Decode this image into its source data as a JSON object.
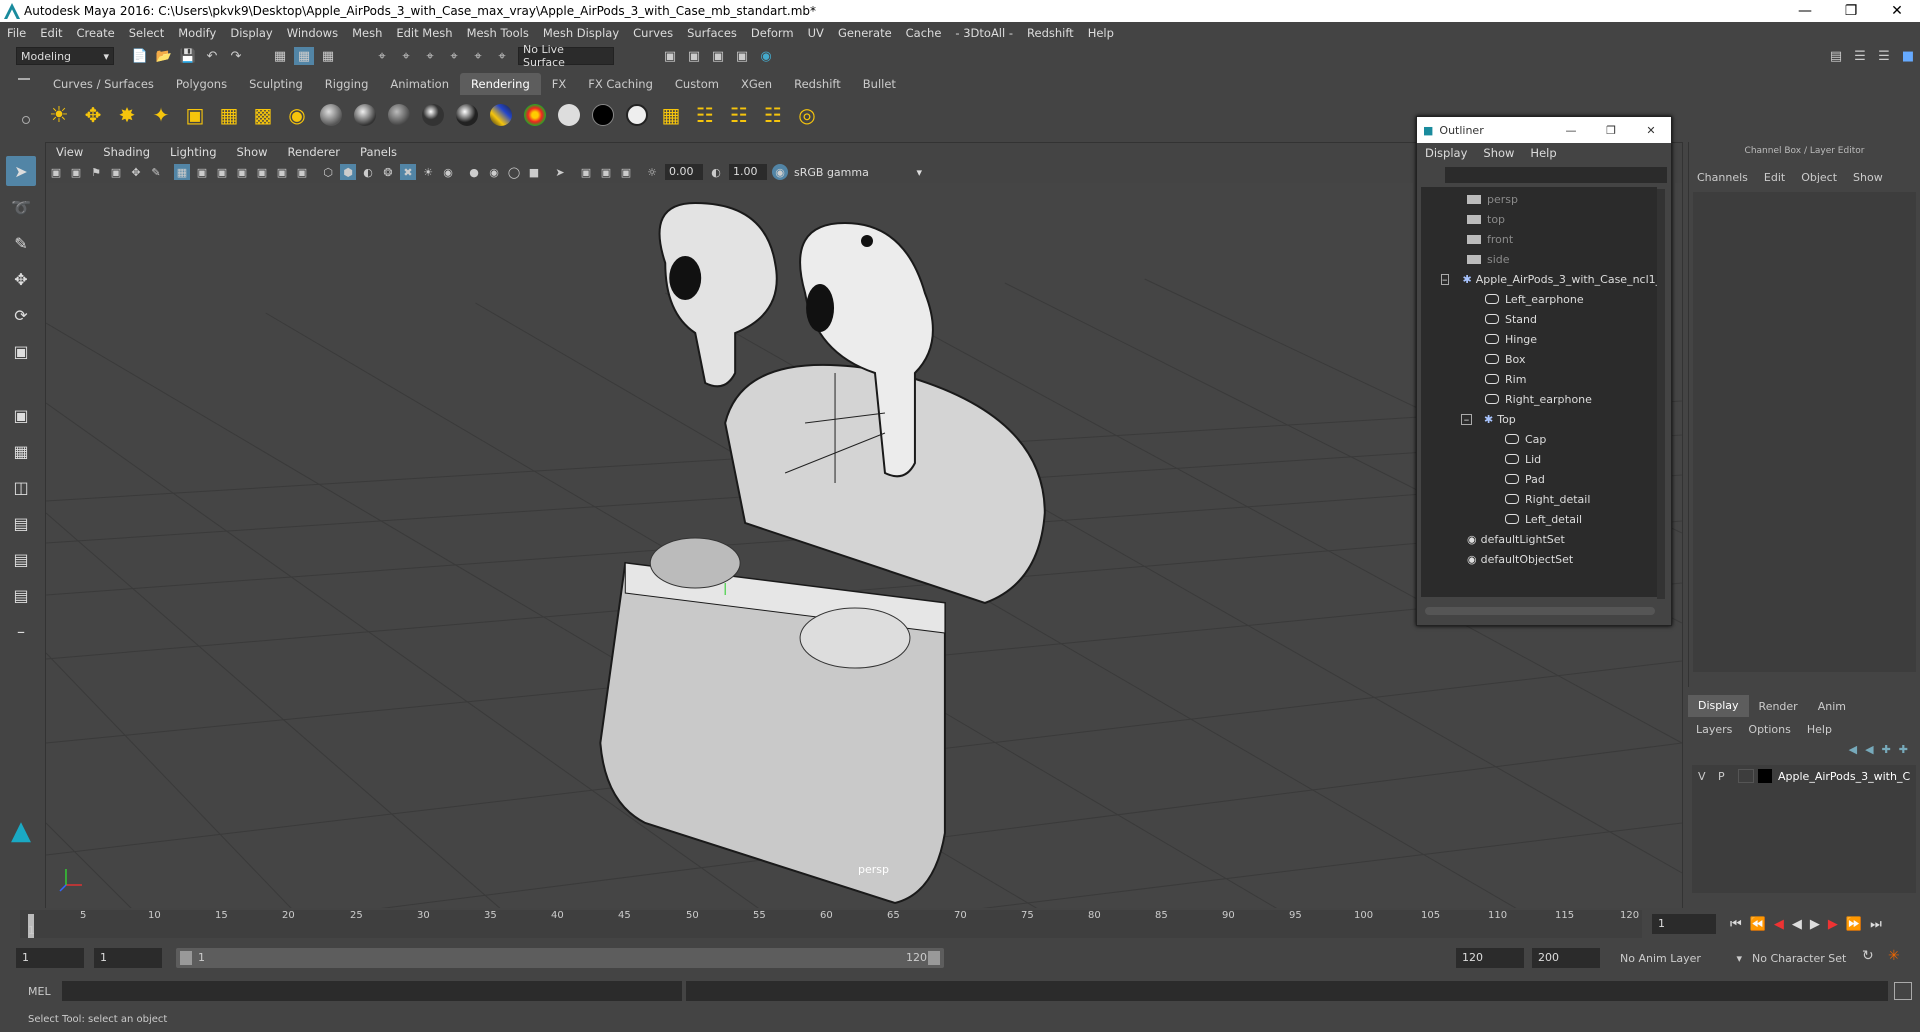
{
  "window": {
    "title": "Autodesk Maya 2016: C:\\Users\\pkvk9\\Desktop\\Apple_AirPods_3_with_Case_max_vray\\Apple_AirPods_3_with_Case_mb_standart.mb*"
  },
  "menubar": [
    "File",
    "Edit",
    "Create",
    "Select",
    "Modify",
    "Display",
    "Windows",
    "Mesh",
    "Edit Mesh",
    "Mesh Tools",
    "Mesh Display",
    "Curves",
    "Surfaces",
    "Deform",
    "UV",
    "Generate",
    "Cache",
    "- 3DtoAll -",
    "Redshift",
    "Help"
  ],
  "statusline": {
    "mode": "Modeling",
    "live_surface": "No Live Surface"
  },
  "shelf_tabs": [
    {
      "label": "Curves / Surfaces",
      "active": false
    },
    {
      "label": "Polygons",
      "active": false
    },
    {
      "label": "Sculpting",
      "active": false
    },
    {
      "label": "Rigging",
      "active": false
    },
    {
      "label": "Animation",
      "active": false
    },
    {
      "label": "Rendering",
      "active": true
    },
    {
      "label": "FX",
      "active": false
    },
    {
      "label": "FX Caching",
      "active": false
    },
    {
      "label": "Custom",
      "active": false
    },
    {
      "label": "XGen",
      "active": false
    },
    {
      "label": "Redshift",
      "active": false
    },
    {
      "label": "Bullet",
      "active": false
    }
  ],
  "viewport": {
    "menu": [
      "View",
      "Shading",
      "Lighting",
      "Show",
      "Renderer",
      "Panels"
    ],
    "exposure": "0.00",
    "gamma": "1.00",
    "color_space": "sRGB gamma",
    "camera_label": "persp"
  },
  "outliner": {
    "title": "Outliner",
    "menu": [
      "Display",
      "Show",
      "Help"
    ],
    "items": [
      {
        "label": "persp",
        "type": "camera",
        "dim": true
      },
      {
        "label": "top",
        "type": "camera",
        "dim": true
      },
      {
        "label": "front",
        "type": "camera",
        "dim": true
      },
      {
        "label": "side",
        "type": "camera",
        "dim": true
      },
      {
        "label": "Apple_AirPods_3_with_Case_ncl1_",
        "type": "group"
      },
      {
        "label": "Left_earphone",
        "type": "mesh"
      },
      {
        "label": "Stand",
        "type": "mesh"
      },
      {
        "label": "Hinge",
        "type": "mesh"
      },
      {
        "label": "Box",
        "type": "mesh"
      },
      {
        "label": "Rim",
        "type": "mesh"
      },
      {
        "label": "Right_earphone",
        "type": "mesh"
      },
      {
        "label": "Top",
        "type": "group"
      },
      {
        "label": "Cap",
        "type": "mesh"
      },
      {
        "label": "Lid",
        "type": "mesh"
      },
      {
        "label": "Pad",
        "type": "mesh"
      },
      {
        "label": "Right_detail",
        "type": "mesh"
      },
      {
        "label": "Left_detail",
        "type": "mesh"
      },
      {
        "label": "defaultLightSet",
        "type": "set"
      },
      {
        "label": "defaultObjectSet",
        "type": "set"
      }
    ]
  },
  "channelbox": {
    "title": "Channel Box / Layer Editor",
    "menu": [
      "Channels",
      "Edit",
      "Object",
      "Show"
    ]
  },
  "layereditor": {
    "tabs": [
      "Display",
      "Render",
      "Anim"
    ],
    "menu": [
      "Layers",
      "Options",
      "Help"
    ],
    "layer": {
      "v": "V",
      "p": "P",
      "name": "Apple_AirPods_3_with_C"
    }
  },
  "timeline": {
    "ticks": [
      "1",
      "5",
      "10",
      "15",
      "20",
      "25",
      "30",
      "35",
      "40",
      "45",
      "50",
      "55",
      "60",
      "65",
      "70",
      "75",
      "80",
      "85",
      "90",
      "95",
      "100",
      "105",
      "110",
      "115",
      "120"
    ],
    "current_frame": "1",
    "range_start": "1",
    "range_start2": "1",
    "range_inner_start": "1",
    "range_inner_end": "120",
    "range_end": "120",
    "range_end2": "200",
    "anim_layer": "No Anim Layer",
    "char_set": "No Character Set"
  },
  "cmdline": {
    "lang": "MEL"
  },
  "helpline": {
    "text": "Select Tool: select an object"
  }
}
